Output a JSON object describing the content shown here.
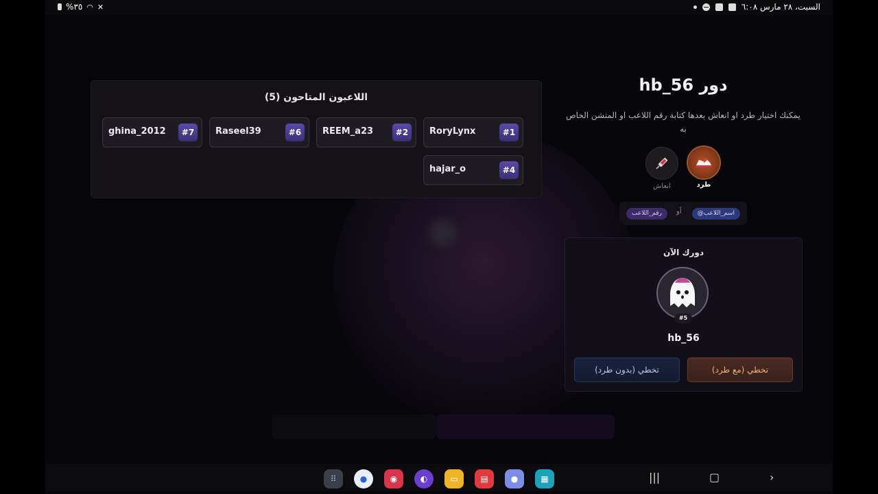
{
  "status_bar": {
    "datetime": "السبت، ٢٨ مارس ٦:٠٨",
    "battery": "%٣٥"
  },
  "players_panel": {
    "title": "اللاعبون المتاحون (5)",
    "players": [
      {
        "name": "RoryLynx",
        "number": "#1"
      },
      {
        "name": "REEM_a23",
        "number": "#2"
      },
      {
        "name": "Raseel39",
        "number": "#6"
      },
      {
        "name": "ghina_2012",
        "number": "#7"
      },
      {
        "name": "hajar_o",
        "number": "#4"
      }
    ]
  },
  "turn_panel": {
    "title": "دور hb_56",
    "description": "يمكنك اختيار طرد او انعاش بعدها كتابة رقم اللاعب او المنشن الخاص به",
    "actions": [
      {
        "label": "طرد",
        "icon": "sneaker-icon",
        "selected": true
      },
      {
        "label": "انعاش",
        "icon": "syringe-icon",
        "selected": false
      }
    ],
    "hint": {
      "chip_mention": "@اسم_اللاعب",
      "or": "أو",
      "chip_number": "رقم_اللاعب"
    }
  },
  "current_turn": {
    "title": "دورك الآن",
    "player_name": "hb_56",
    "player_number": "#5",
    "avatar": "ghost-icon",
    "skip_with_kick": "تخطي (مع طرد)",
    "skip_without_kick": "تخطي (بدون طرد)"
  },
  "colors": {
    "accent_purple": "#5a4aa8",
    "kick_orange": "#f0b27a",
    "skip_blue": "#b9c8ee"
  }
}
